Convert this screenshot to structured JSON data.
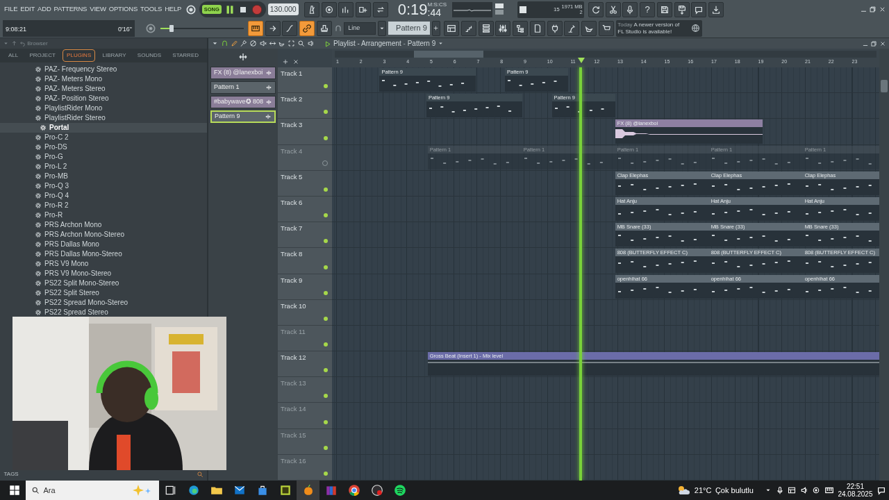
{
  "menu": [
    "FILE",
    "EDIT",
    "ADD",
    "PATTERNS",
    "VIEW",
    "OPTIONS",
    "TOOLS",
    "HELP"
  ],
  "transport": {
    "song_mode": true,
    "song_label": "SONG",
    "playing": true,
    "recording": false,
    "tempo": "130.000"
  },
  "time": {
    "value": "0:19",
    "centis": ":44",
    "unit": "M:S:CS"
  },
  "cpu": {
    "polyphony": "15",
    "memory": "1971 MB",
    "count": "2"
  },
  "help_label": "?",
  "hint": {
    "position": "9:08:21",
    "duration": "0'16\""
  },
  "master_volume": {
    "level": 0.13
  },
  "tool_toggles": [
    {
      "on": true
    },
    {
      "on": false
    },
    {
      "on": false
    },
    {
      "on": true
    },
    {
      "on": false
    }
  ],
  "snap": "Line",
  "pattern_selector": "Pattern 9",
  "news": {
    "when": "Today",
    "message": "A newer version of FL Studio is available!"
  },
  "browser": {
    "title": "Browser",
    "tabs": [
      {
        "label": "ALL",
        "selected": false
      },
      {
        "label": "PROJECT",
        "selected": false
      },
      {
        "label": "PLUGINS",
        "selected": true
      },
      {
        "label": "LIBRARY",
        "selected": false
      },
      {
        "label": "SOUNDS",
        "selected": false
      },
      {
        "label": "STARRED",
        "selected": false
      }
    ],
    "items": [
      {
        "label": "PAZ- Frequency Stereo",
        "selected": false
      },
      {
        "label": "PAZ- Meters Mono",
        "selected": false
      },
      {
        "label": "PAZ- Meters Stereo",
        "selected": false
      },
      {
        "label": "PAZ- Position Stereo",
        "selected": false
      },
      {
        "label": "PlaylistRider Mono",
        "selected": false
      },
      {
        "label": "PlaylistRider Stereo",
        "selected": false
      },
      {
        "label": "Portal",
        "selected": true
      },
      {
        "label": "Pro-C 2",
        "selected": false
      },
      {
        "label": "Pro-DS",
        "selected": false
      },
      {
        "label": "Pro-G",
        "selected": false
      },
      {
        "label": "Pro-L 2",
        "selected": false
      },
      {
        "label": "Pro-MB",
        "selected": false
      },
      {
        "label": "Pro-Q 3",
        "selected": false
      },
      {
        "label": "Pro-Q 4",
        "selected": false
      },
      {
        "label": "Pro-R 2",
        "selected": false
      },
      {
        "label": "Pro-R",
        "selected": false
      },
      {
        "label": "PRS Archon Mono",
        "selected": false
      },
      {
        "label": "PRS Archon Mono-Stereo",
        "selected": false
      },
      {
        "label": "PRS Dallas Mono",
        "selected": false
      },
      {
        "label": "PRS Dallas Mono-Stereo",
        "selected": false
      },
      {
        "label": "PRS V9 Mono",
        "selected": false
      },
      {
        "label": "PRS V9 Mono-Stereo",
        "selected": false
      },
      {
        "label": "PS22 Split Mono-Stereo",
        "selected": false
      },
      {
        "label": "PS22 Split Stereo",
        "selected": false
      },
      {
        "label": "PS22 Spread Mono-Stereo",
        "selected": false
      },
      {
        "label": "PS22 Spread Stereo",
        "selected": false
      }
    ],
    "tags_label": "TAGS"
  },
  "playlist": {
    "title": "Playlist - Arrangement",
    "separator": "-",
    "pattern": "Pattern 9",
    "picker": [
      {
        "label": "FX (8) @lanexboi",
        "color": "#8a7d98",
        "selected": false
      },
      {
        "label": "Pattern 1",
        "color": "#5b646a",
        "selected": false
      },
      {
        "label": "#babywave✪ 808",
        "color": "#8a7d98",
        "selected": false
      },
      {
        "label": "Pattern 9",
        "color": "#5b646a",
        "selected": true
      }
    ],
    "bars": [
      "1",
      "2",
      "3",
      "4",
      "5",
      "6",
      "7",
      "8",
      "9",
      "10",
      "11",
      "12",
      "13",
      "14",
      "15",
      "16",
      "17",
      "18",
      "19",
      "20",
      "21",
      "22",
      "23"
    ],
    "tracks": [
      {
        "name": "Track 1",
        "muted": false,
        "dimmed": false,
        "clips": [
          {
            "kind": "pattern",
            "label": "Pattern 9",
            "color": "#3b4850"
          },
          {
            "kind": "pattern",
            "label": "Pattern 9",
            "color": "#3b4850"
          }
        ]
      },
      {
        "name": "Track 2",
        "muted": false,
        "dimmed": false,
        "clips": [
          {
            "kind": "pattern",
            "label": "Pattern 9",
            "color": "#3b4850"
          },
          {
            "kind": "pattern",
            "label": "Pattern 9",
            "color": "#3b4850"
          }
        ]
      },
      {
        "name": "Track 3",
        "muted": false,
        "dimmed": false,
        "clips": [
          {
            "kind": "audio",
            "label": "FX (8) @lanexboi",
            "color": "#8e80a2"
          }
        ]
      },
      {
        "name": "Track 4",
        "muted": true,
        "dimmed": true,
        "clips": [
          {
            "kind": "pattern",
            "label": "Pattern 1",
            "color": "#48535a"
          },
          {
            "kind": "pattern",
            "label": "Pattern 1",
            "color": "#48535a"
          },
          {
            "kind": "pattern",
            "label": "Pattern 1",
            "color": "#48535a"
          },
          {
            "kind": "pattern",
            "label": "Pattern 1",
            "color": "#48535a"
          },
          {
            "kind": "pattern",
            "label": "Pattern 1",
            "color": "#48535a"
          }
        ]
      },
      {
        "name": "Track 5",
        "muted": false,
        "dimmed": false,
        "clips": [
          {
            "kind": "pattern",
            "label": "Clap Elephas",
            "color": "#5e6a73"
          },
          {
            "kind": "pattern",
            "label": "Clap Elephas",
            "color": "#5e6a73"
          },
          {
            "kind": "pattern",
            "label": "Clap Elephas",
            "color": "#5e6a73"
          }
        ]
      },
      {
        "name": "Track 6",
        "muted": false,
        "dimmed": false,
        "clips": [
          {
            "kind": "pattern",
            "label": "Hat Anju",
            "color": "#5e6a73"
          },
          {
            "kind": "pattern",
            "label": "Hat Anju",
            "color": "#5e6a73"
          },
          {
            "kind": "pattern",
            "label": "Hat Anju",
            "color": "#5e6a73"
          }
        ]
      },
      {
        "name": "Track 7",
        "muted": false,
        "dimmed": false,
        "clips": [
          {
            "kind": "pattern",
            "label": "MB Snare (33)",
            "color": "#5e6a73"
          },
          {
            "kind": "pattern",
            "label": "MB Snare (33)",
            "color": "#5e6a73"
          },
          {
            "kind": "pattern",
            "label": "MB Snare (33)",
            "color": "#5e6a73"
          }
        ]
      },
      {
        "name": "Track 8",
        "muted": false,
        "dimmed": false,
        "clips": [
          {
            "kind": "pattern",
            "label": "808 (BUTTERFLY EFFECT C)",
            "color": "#5e6a73"
          },
          {
            "kind": "pattern",
            "label": "808 (BUTTERFLY EFFECT C)",
            "color": "#5e6a73"
          },
          {
            "kind": "pattern",
            "label": "808 (BUTTERFLY EFFECT C)",
            "color": "#5e6a73"
          }
        ]
      },
      {
        "name": "Track 9",
        "muted": false,
        "dimmed": false,
        "clips": [
          {
            "kind": "pattern",
            "label": "openhihat 66",
            "color": "#5e6a73"
          },
          {
            "kind": "pattern",
            "label": "openhihat 66",
            "color": "#5e6a73"
          },
          {
            "kind": "pattern",
            "label": "openhihat 66",
            "color": "#5e6a73"
          }
        ]
      },
      {
        "name": "Track 10",
        "muted": false,
        "dimmed": false
      },
      {
        "name": "Track 11",
        "muted": false,
        "dimmed": true
      },
      {
        "name": "Track 12",
        "muted": false,
        "dimmed": false,
        "clips": [
          {
            "kind": "automation",
            "label": "Gross Beat (Insert 1) - Mix level",
            "color": "#6b6ca8"
          }
        ]
      },
      {
        "name": "Track 13",
        "muted": false,
        "dimmed": true
      },
      {
        "name": "Track 14",
        "muted": false,
        "dimmed": true
      },
      {
        "name": "Track 15",
        "muted": false,
        "dimmed": true
      },
      {
        "name": "Track 16",
        "muted": false,
        "dimmed": true
      }
    ]
  },
  "taskbar": {
    "search": "Ara",
    "weather_temp": "21°C",
    "weather_text": "Çok bulutlu",
    "time": "22:51",
    "date": "24.08.2025"
  }
}
